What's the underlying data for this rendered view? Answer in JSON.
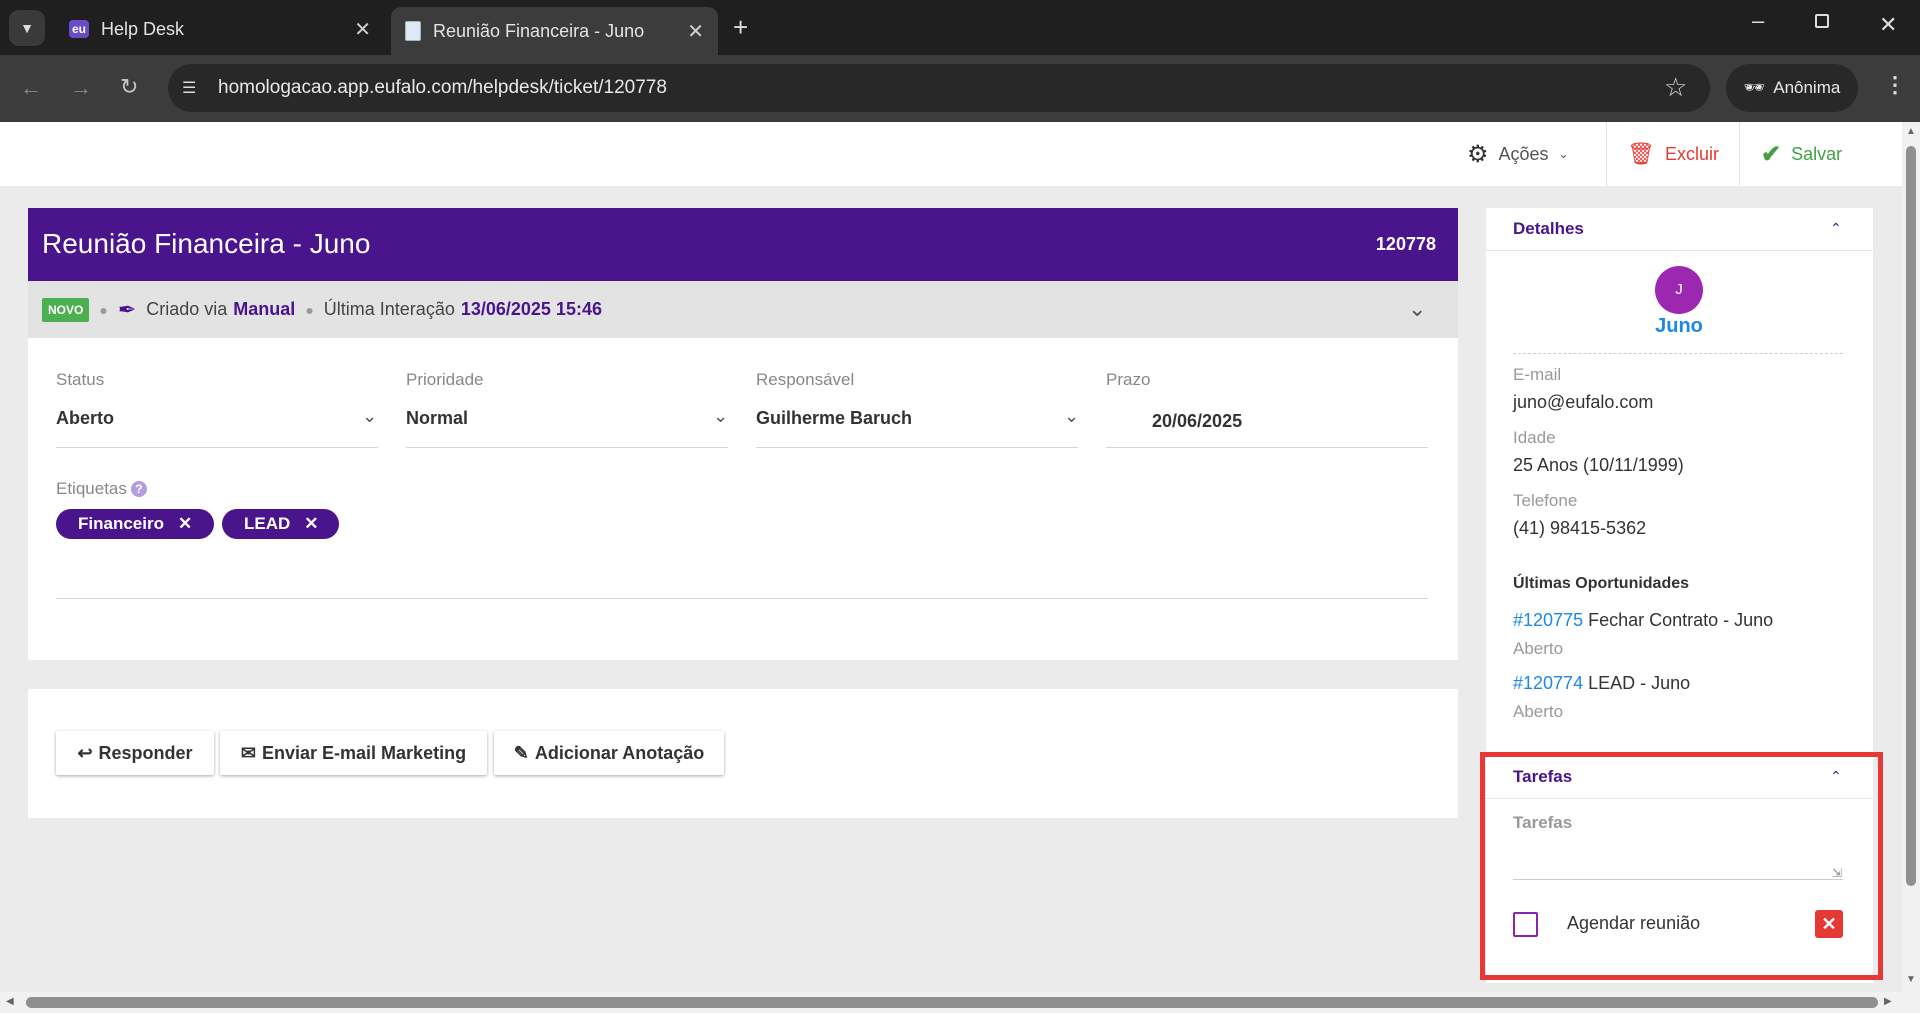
{
  "browser": {
    "tabs": [
      {
        "label": "Help Desk",
        "icon": "eu-logo-icon"
      },
      {
        "label": "Reunião Financeira - Juno",
        "icon": "document-icon",
        "active": true
      }
    ],
    "url": "homologacao.app.eufalo.com/helpdesk/ticket/120778",
    "incognito_label": "Anônima"
  },
  "header": {
    "actions_label": "Ações",
    "delete_label": "Excluir",
    "save_label": "Salvar"
  },
  "ticket": {
    "title": "Reunião Financeira - Juno",
    "id": "120778",
    "status_badge": "NOVO",
    "created_via_prefix": "Criado via",
    "created_via": "Manual",
    "last_interaction_label": "Última Interação",
    "last_interaction": "13/06/2025 15:46",
    "fields": {
      "status": {
        "label": "Status",
        "value": "Aberto"
      },
      "priority": {
        "label": "Prioridade",
        "value": "Normal"
      },
      "owner": {
        "label": "Responsável",
        "value": "Guilherme Baruch"
      },
      "deadline": {
        "label": "Prazo",
        "value": "20/06/2025"
      }
    },
    "tags_label": "Etiquetas",
    "tags": [
      "Financeiro",
      "LEAD"
    ]
  },
  "reply_actions": {
    "reply": "Responder",
    "email_marketing": "Enviar E-mail Marketing",
    "add_note": "Adicionar Anotação"
  },
  "details": {
    "header": "Detalhes",
    "avatar_initial": "J",
    "name": "Juno",
    "email_label": "E-mail",
    "email": "juno@eufalo.com",
    "age_label": "Idade",
    "age": "25 Anos (10/11/1999)",
    "phone_label": "Telefone",
    "phone": "(41) 98415-5362",
    "opps_header": "Últimas Oportunidades",
    "opps": [
      {
        "id": "#120775",
        "title": "Fechar Contrato - Juno",
        "status": "Aberto"
      },
      {
        "id": "#120774",
        "title": "LEAD - Juno",
        "status": "Aberto"
      }
    ]
  },
  "tasks": {
    "header": "Tarefas",
    "field_label": "Tarefas",
    "items": [
      {
        "label": "Agendar reunião",
        "checked": false
      }
    ]
  },
  "colors": {
    "brand": "#4a148c",
    "highlight": "#e53935",
    "link": "#1e88e5",
    "badge": "#4caf50"
  }
}
